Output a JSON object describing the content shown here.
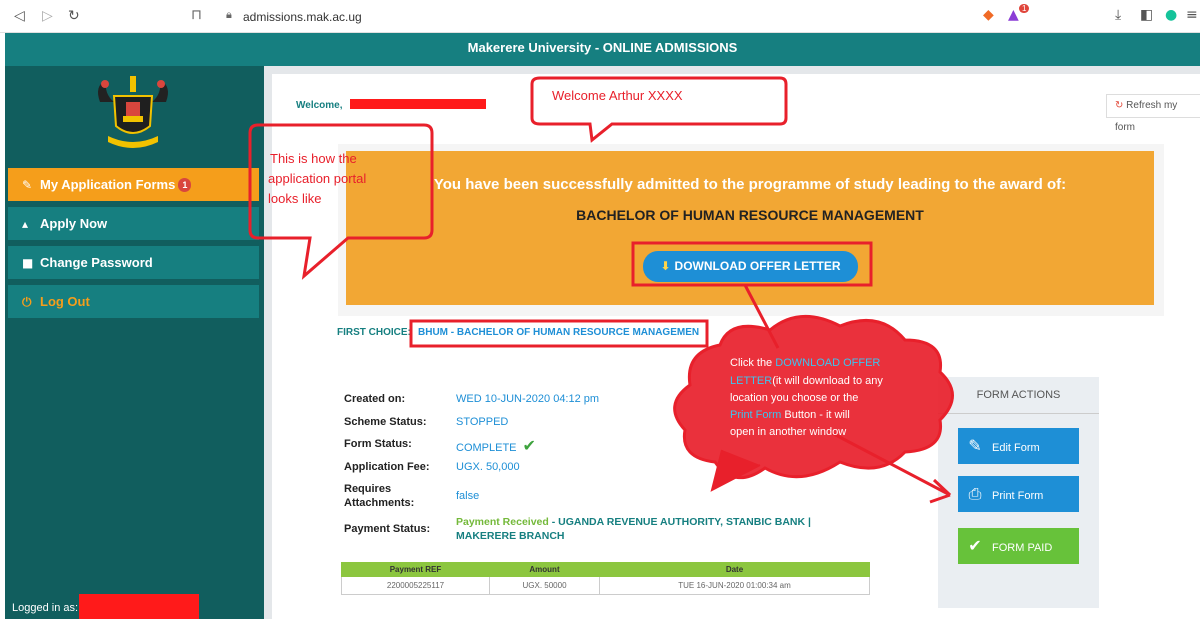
{
  "browser": {
    "url": "admissions.mak.ac.ug",
    "ext_badge": "1"
  },
  "header": {
    "title": "Makerere University - ONLINE ADMISSIONS"
  },
  "sidebar": {
    "items": [
      {
        "label": "My Application Forms",
        "badge": "1"
      },
      {
        "label": "Apply Now"
      },
      {
        "label": "Change Password"
      },
      {
        "label": "Log Out"
      }
    ],
    "logged_in_label": "Logged in as:"
  },
  "main": {
    "welcome": "Welcome,",
    "refresh_label": "Refresh my form",
    "admit_message": "You have been successfully admitted to the programme of study leading to the award of:",
    "programme": "BACHELOR OF HUMAN RESOURCE MANAGEMENT",
    "download_label": "DOWNLOAD OFFER LETTER",
    "first_choice_label": "FIRST CHOICE:",
    "first_choice_value": "BHUM - BACHELOR OF HUMAN RESOURCE MANAGEMEN",
    "details": {
      "created_label": "Created on:",
      "created_value": "WED 10-JUN-2020 04:12 pm",
      "scheme_label": "Scheme Status:",
      "scheme_value": "STOPPED",
      "form_status_label": "Form Status:",
      "form_status_value": "COMPLETE",
      "fee_label": "Application Fee:",
      "fee_value": "UGX. 50,000",
      "attach_label_1": "Requires",
      "attach_label_2": "Attachments:",
      "attach_value": "false",
      "payment_label": "Payment Status:",
      "payment_received": "Payment Received",
      "payment_rest_1": " - UGANDA REVENUE AUTHORITY, STANBIC BANK |",
      "payment_rest_2": "MAKERERE BRANCH"
    },
    "payments": {
      "headers": [
        "Payment REF",
        "Amount",
        "Date"
      ],
      "rows": [
        [
          "2200005225117",
          "UGX. 50000",
          "TUE 16-JUN-2020 01:00:34 am"
        ]
      ]
    },
    "actions": {
      "title": "FORM ACTIONS",
      "edit": "Edit Form",
      "print": "Print Form",
      "paid": "FORM PAID"
    }
  },
  "annotations": {
    "welcome_callout": "Welcome Arthur XXXX",
    "portal_line1": "This is how the",
    "portal_line2": "application portal",
    "portal_line3": "looks like",
    "cloud_1": "Click the ",
    "cloud_2": "DOWNLOAD OFFER",
    "cloud_3": "LETTER",
    "cloud_4": "(it will download to any",
    "cloud_5": "location you choose or the",
    "cloud_6": "Print Form",
    "cloud_7": " Button - it will",
    "cloud_8": "open in another window"
  },
  "colors": {
    "teal": "#167f80",
    "sidebar": "#115e5e",
    "orange": "#f2a734",
    "blue": "#1e8fd6",
    "green": "#67c23a",
    "annotation_red": "#e8202b"
  }
}
